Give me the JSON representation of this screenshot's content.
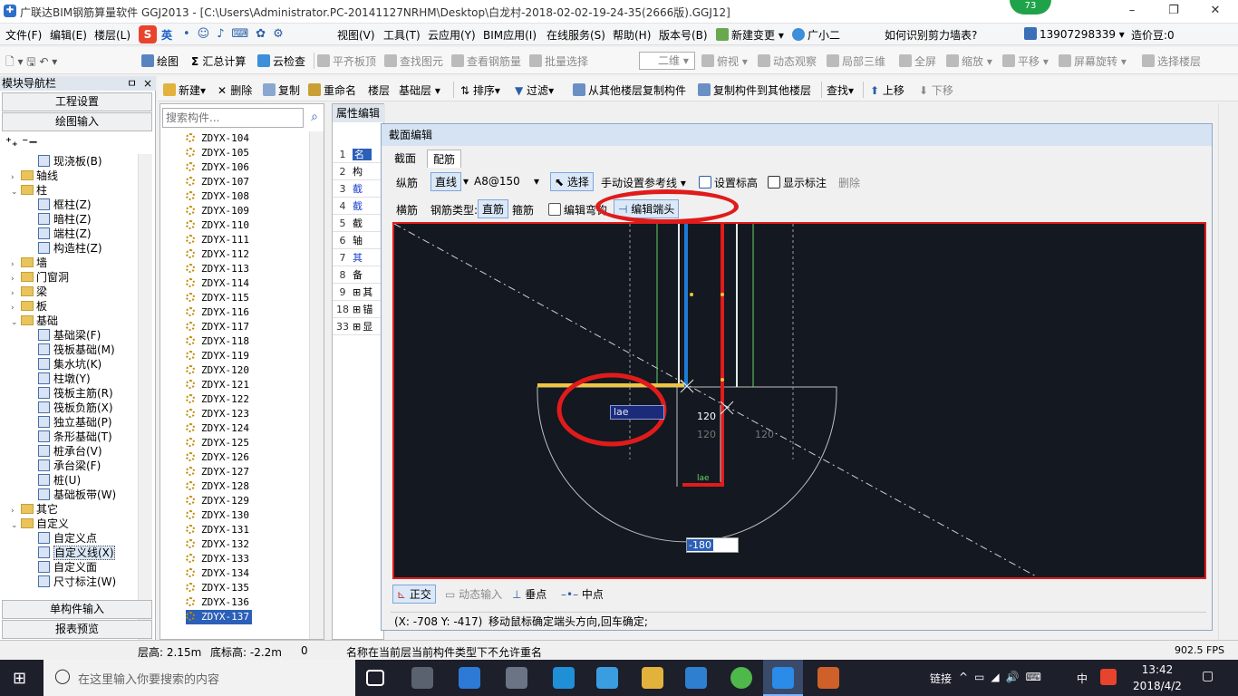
{
  "titlebar": {
    "title": "广联达BIM钢筋算量软件 GGJ2013 - [C:\\Users\\Administrator.PC-20141127NRHM\\Desktop\\白龙村-2018-02-02-19-24-35(2666版).GGJ12]",
    "badge": "73",
    "minimize": "–",
    "restore": "❐",
    "close": "✕"
  },
  "menubar": {
    "items": [
      "文件(F)",
      "编辑(E)",
      "楼层(L)",
      "视图(V)",
      "工具(T)",
      "云应用(Y)",
      "BIM应用(I)",
      "在线服务(S)",
      "帮助(H)",
      "版本号(B)",
      "新建变更",
      "广小二"
    ],
    "ime_label": "英",
    "question": "如何识别剪力墙表?",
    "phone": "13907298339",
    "coins": "造价豆:0"
  },
  "toolbar1": {
    "items": [
      "绘图",
      "汇总计算",
      "云检查",
      "平齐板顶",
      "查找图元",
      "查看钢筋量",
      "批量选择",
      "二维",
      "俯视",
      "动态观察",
      "局部三维",
      "全屏",
      "缩放",
      "平移",
      "屏幕旋转",
      "选择楼层"
    ]
  },
  "toolbar2": {
    "items": [
      "新建",
      "删除",
      "复制",
      "重命名",
      "楼层",
      "基础层",
      "排序",
      "过滤",
      "从其他楼层复制构件",
      "复制构件到其他楼层",
      "查找",
      "上移",
      "下移"
    ]
  },
  "leftnav": {
    "title": "模块导航栏",
    "pin": "ㅁ",
    "close": "×",
    "buttons": [
      "工程设置",
      "绘图输入",
      "单构件输入",
      "报表预览"
    ],
    "tree": [
      {
        "label": "现浇板(B)",
        "level": 2,
        "kind": "comp"
      },
      {
        "label": "轴线",
        "level": 0,
        "kind": "folder",
        "toggle": "›"
      },
      {
        "label": "柱",
        "level": 0,
        "kind": "folder",
        "toggle": "⌄"
      },
      {
        "label": "框柱(Z)",
        "level": 2,
        "kind": "comp"
      },
      {
        "label": "暗柱(Z)",
        "level": 2,
        "kind": "comp"
      },
      {
        "label": "端柱(Z)",
        "level": 2,
        "kind": "comp"
      },
      {
        "label": "构造柱(Z)",
        "level": 2,
        "kind": "comp"
      },
      {
        "label": "墙",
        "level": 0,
        "kind": "folder",
        "toggle": "›"
      },
      {
        "label": "门窗洞",
        "level": 0,
        "kind": "folder",
        "toggle": "›"
      },
      {
        "label": "梁",
        "level": 0,
        "kind": "folder",
        "toggle": "›"
      },
      {
        "label": "板",
        "level": 0,
        "kind": "folder",
        "toggle": "›"
      },
      {
        "label": "基础",
        "level": 0,
        "kind": "folder",
        "toggle": "⌄"
      },
      {
        "label": "基础梁(F)",
        "level": 2,
        "kind": "comp"
      },
      {
        "label": "筏板基础(M)",
        "level": 2,
        "kind": "comp"
      },
      {
        "label": "集水坑(K)",
        "level": 2,
        "kind": "comp"
      },
      {
        "label": "柱墩(Y)",
        "level": 2,
        "kind": "comp"
      },
      {
        "label": "筏板主筋(R)",
        "level": 2,
        "kind": "comp"
      },
      {
        "label": "筏板负筋(X)",
        "level": 2,
        "kind": "comp"
      },
      {
        "label": "独立基础(P)",
        "level": 2,
        "kind": "comp"
      },
      {
        "label": "条形基础(T)",
        "level": 2,
        "kind": "comp"
      },
      {
        "label": "桩承台(V)",
        "level": 2,
        "kind": "comp"
      },
      {
        "label": "承台梁(F)",
        "level": 2,
        "kind": "comp"
      },
      {
        "label": "桩(U)",
        "level": 2,
        "kind": "comp"
      },
      {
        "label": "基础板带(W)",
        "level": 2,
        "kind": "comp"
      },
      {
        "label": "其它",
        "level": 0,
        "kind": "folder",
        "toggle": "›"
      },
      {
        "label": "自定义",
        "level": 0,
        "kind": "folder",
        "toggle": "⌄"
      },
      {
        "label": "自定义点",
        "level": 2,
        "kind": "comp"
      },
      {
        "label": "自定义线(X)",
        "level": 2,
        "kind": "comp",
        "selected": true
      },
      {
        "label": "自定义面",
        "level": 2,
        "kind": "comp"
      },
      {
        "label": "尺寸标注(W)",
        "level": 2,
        "kind": "comp"
      }
    ]
  },
  "complist": {
    "search_placeholder": "搜索构件...",
    "items": [
      "ZDYX-104",
      "ZDYX-105",
      "ZDYX-106",
      "ZDYX-107",
      "ZDYX-108",
      "ZDYX-109",
      "ZDYX-110",
      "ZDYX-111",
      "ZDYX-112",
      "ZDYX-113",
      "ZDYX-114",
      "ZDYX-115",
      "ZDYX-116",
      "ZDYX-117",
      "ZDYX-118",
      "ZDYX-119",
      "ZDYX-120",
      "ZDYX-121",
      "ZDYX-122",
      "ZDYX-123",
      "ZDYX-124",
      "ZDYX-125",
      "ZDYX-126",
      "ZDYX-127",
      "ZDYX-128",
      "ZDYX-129",
      "ZDYX-130",
      "ZDYX-131",
      "ZDYX-132",
      "ZDYX-133",
      "ZDYX-134",
      "ZDYX-135",
      "ZDYX-136",
      "ZDYX-137"
    ],
    "selected": "ZDYX-137"
  },
  "proppanel": {
    "tab": "属性编辑",
    "rows": [
      {
        "num": "1",
        "text": "名",
        "selected": true
      },
      {
        "num": "2",
        "text": "构"
      },
      {
        "num": "3",
        "text": "截",
        "blue": true
      },
      {
        "num": "4",
        "text": "截",
        "blue": true
      },
      {
        "num": "5",
        "text": "截"
      },
      {
        "num": "6",
        "text": "轴"
      },
      {
        "num": "7",
        "text": "其",
        "blue": true
      },
      {
        "num": "8",
        "text": "备"
      },
      {
        "num": "9",
        "text": "其",
        "plus": true
      },
      {
        "num": "18",
        "text": "锚",
        "plus": true
      },
      {
        "num": "33",
        "text": "显",
        "plus": true
      }
    ]
  },
  "dialog": {
    "title": "截面编辑",
    "tabs": [
      "截面",
      "配筋"
    ],
    "row1": {
      "label": "纵筋",
      "line_btn": "直线",
      "spec": "A8@150",
      "select_btn": "选择",
      "manual_ref": "手动设置参考线",
      "set_elev": "设置标高",
      "show_dim": "显示标注",
      "delete": "删除"
    },
    "row2": {
      "label": "横筋",
      "type_label": "钢筋类型:",
      "straight": "直筋",
      "stirrup": "箍筋",
      "edit_bend": "编辑弯钩",
      "edit_end": "编辑端头"
    },
    "canvas": {
      "input_lae": "lae",
      "dim_120a": "120",
      "dim_120b": "120",
      "dim_120c": "120",
      "label_lae": "lae",
      "input_value": "-180"
    },
    "bottom": {
      "ortho": "正交",
      "dynamic_input": "动态输入",
      "midpoint_vert": "垂点",
      "midpoint": "中点"
    },
    "status": {
      "coords": "(X: -708 Y: -417)",
      "hint": "移动鼠标确定端头方向,回车确定;"
    }
  },
  "statusbar": {
    "floor_height": "层高: 2.15m",
    "base_elev": "底标高: -2.2m",
    "zero": "0",
    "message": "名称在当前层当前构件类型下不允许重名",
    "fps": "902.5 FPS"
  },
  "taskbar": {
    "search_placeholder": "在这里输入你要搜索的内容",
    "link": "链接",
    "lang": "中",
    "time": "13:42",
    "date": "2018/4/2"
  },
  "colors": {
    "annotation_red": "#e01b1b",
    "selection_blue": "#2b5fb8",
    "canvas_bg": "#141820"
  }
}
